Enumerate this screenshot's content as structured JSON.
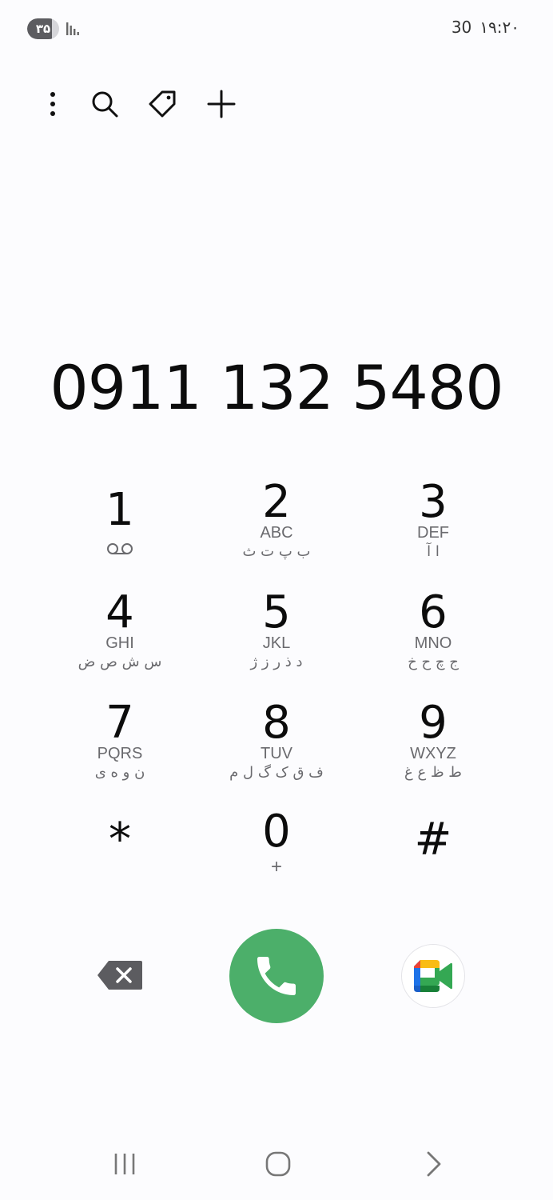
{
  "status_bar": {
    "battery_level": "۳۵",
    "battery_percent": 78,
    "notification_count": "30",
    "time": "۱۹:۲۰"
  },
  "toolbar": {
    "icons": [
      "more-options-icon",
      "search-icon",
      "tag-icon",
      "add-contact-icon"
    ]
  },
  "dialer": {
    "number": "0911 132 5480"
  },
  "keypad": {
    "keys": [
      {
        "digit": "1",
        "letters": "",
        "persian": "",
        "sub": ""
      },
      {
        "digit": "2",
        "letters": "ABC",
        "persian": "ب پ ت ث",
        "sub": ""
      },
      {
        "digit": "3",
        "letters": "DEF",
        "persian": "ا آ",
        "sub": ""
      },
      {
        "digit": "4",
        "letters": "GHI",
        "persian": "س ش ص ض",
        "sub": ""
      },
      {
        "digit": "5",
        "letters": "JKL",
        "persian": "د ذ ر ز ژ",
        "sub": ""
      },
      {
        "digit": "6",
        "letters": "MNO",
        "persian": "ج چ ح خ",
        "sub": ""
      },
      {
        "digit": "7",
        "letters": "PQRS",
        "persian": "ن و ه ی",
        "sub": ""
      },
      {
        "digit": "8",
        "letters": "TUV",
        "persian": "ف ق ک گ ل م",
        "sub": ""
      },
      {
        "digit": "9",
        "letters": "WXYZ",
        "persian": "ط ظ ع غ",
        "sub": ""
      },
      {
        "digit": "*",
        "letters": "",
        "persian": "",
        "sub": ""
      },
      {
        "digit": "0",
        "letters": "",
        "persian": "",
        "sub": "+"
      },
      {
        "digit": "#",
        "letters": "",
        "persian": "",
        "sub": ""
      }
    ]
  },
  "colors": {
    "call_green": "#4caf6a",
    "background": "#fcfcfe",
    "secondary_text": "#6a6a6e"
  }
}
